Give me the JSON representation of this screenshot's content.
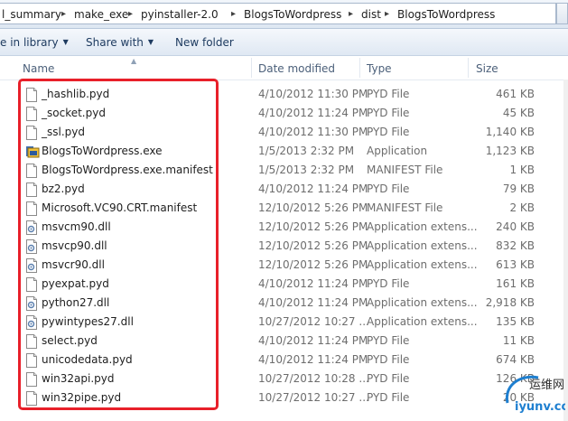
{
  "address_bar": {
    "crumbs": [
      "l_summary",
      "make_exe",
      "pyinstaller-2.0",
      "BlogsToWordpress",
      "dist",
      "BlogsToWordpress"
    ]
  },
  "toolbar": {
    "include_in_library": "e in library",
    "share_with": "Share with",
    "new_folder": "New folder"
  },
  "columns": {
    "name": "Name",
    "date_modified": "Date modified",
    "type": "Type",
    "size": "Size"
  },
  "files": [
    {
      "name": "_hashlib.pyd",
      "date": "4/10/2012 11:30 PM",
      "type": "PYD File",
      "size": "461 KB",
      "icon": "file-icon"
    },
    {
      "name": "_socket.pyd",
      "date": "4/10/2012 11:24 PM",
      "type": "PYD File",
      "size": "45 KB",
      "icon": "file-icon"
    },
    {
      "name": "_ssl.pyd",
      "date": "4/10/2012 11:30 PM",
      "type": "PYD File",
      "size": "1,140 KB",
      "icon": "file-icon"
    },
    {
      "name": "BlogsToWordpress.exe",
      "date": "1/5/2013 2:32 PM",
      "type": "Application",
      "size": "1,123 KB",
      "icon": "application-icon"
    },
    {
      "name": "BlogsToWordpress.exe.manifest",
      "date": "1/5/2013 2:32 PM",
      "type": "MANIFEST File",
      "size": "1 KB",
      "icon": "file-icon"
    },
    {
      "name": "bz2.pyd",
      "date": "4/10/2012 11:24 PM",
      "type": "PYD File",
      "size": "79 KB",
      "icon": "file-icon"
    },
    {
      "name": "Microsoft.VC90.CRT.manifest",
      "date": "12/10/2012 5:26 PM",
      "type": "MANIFEST File",
      "size": "2 KB",
      "icon": "file-icon"
    },
    {
      "name": "msvcm90.dll",
      "date": "12/10/2012 5:26 PM",
      "type": "Application extens...",
      "size": "240 KB",
      "icon": "dll-icon"
    },
    {
      "name": "msvcp90.dll",
      "date": "12/10/2012 5:26 PM",
      "type": "Application extens...",
      "size": "832 KB",
      "icon": "dll-icon"
    },
    {
      "name": "msvcr90.dll",
      "date": "12/10/2012 5:26 PM",
      "type": "Application extens...",
      "size": "613 KB",
      "icon": "dll-icon"
    },
    {
      "name": "pyexpat.pyd",
      "date": "4/10/2012 11:24 PM",
      "type": "PYD File",
      "size": "161 KB",
      "icon": "file-icon"
    },
    {
      "name": "python27.dll",
      "date": "4/10/2012 11:24 PM",
      "type": "Application extens...",
      "size": "2,918 KB",
      "icon": "dll-icon"
    },
    {
      "name": "pywintypes27.dll",
      "date": "10/27/2012 10:27 ...",
      "type": "Application extens...",
      "size": "135 KB",
      "icon": "dll-icon"
    },
    {
      "name": "select.pyd",
      "date": "4/10/2012 11:24 PM",
      "type": "PYD File",
      "size": "11 KB",
      "icon": "file-icon"
    },
    {
      "name": "unicodedata.pyd",
      "date": "4/10/2012 11:24 PM",
      "type": "PYD File",
      "size": "674 KB",
      "icon": "file-icon"
    },
    {
      "name": "win32api.pyd",
      "date": "10/27/2012 10:28 ...",
      "type": "PYD File",
      "size": "126 KB",
      "icon": "file-icon"
    },
    {
      "name": "win32pipe.pyd",
      "date": "10/27/2012 10:27 ...",
      "type": "PYD File",
      "size": "20 KB",
      "icon": "file-icon"
    }
  ],
  "watermark": {
    "title": "运维网",
    "url": "iyunv.com"
  },
  "colors": {
    "highlight_border": "#e8202a",
    "watermark_blue": "#1e7fd0"
  }
}
